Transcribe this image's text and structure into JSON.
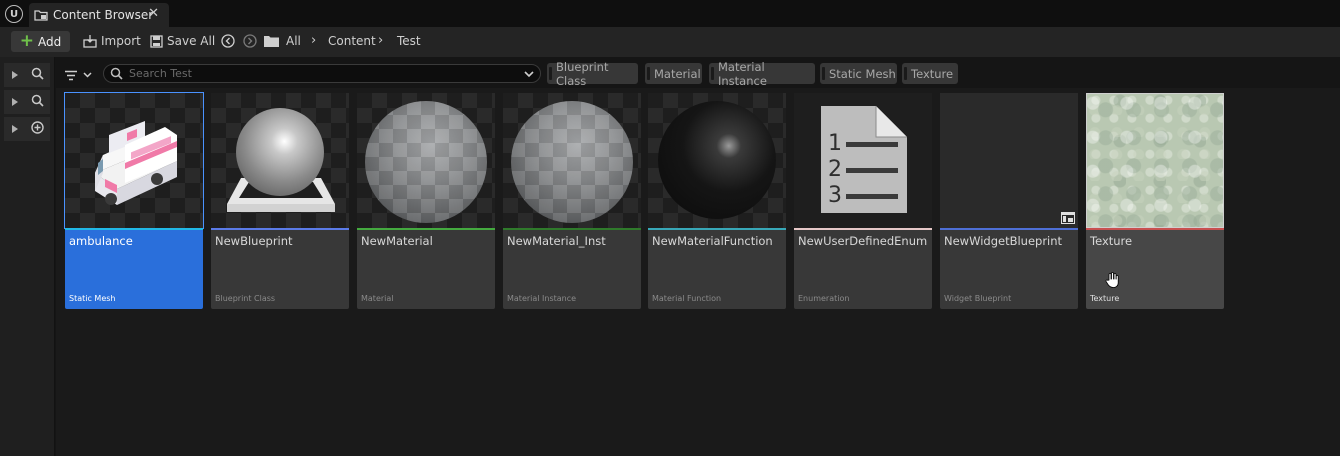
{
  "tab": {
    "title": "Content Browser",
    "close": "✕"
  },
  "toolbar": {
    "add_label": "Add",
    "import_label": "Import",
    "save_all_label": "Save All",
    "breadcrumbs": [
      "All",
      "Content",
      "Test"
    ]
  },
  "search": {
    "placeholder": "Search Test"
  },
  "filters": [
    "Blueprint Class",
    "Material",
    "Material Instance",
    "Static Mesh",
    "Texture"
  ],
  "assets": [
    {
      "name": "ambulance",
      "type": "Static Mesh",
      "color": "#21b8e6"
    },
    {
      "name": "NewBlueprint",
      "type": "Blueprint Class",
      "color": "#5b7be8"
    },
    {
      "name": "NewMaterial",
      "type": "Material",
      "color": "#44aa3f"
    },
    {
      "name": "NewMaterial_Inst",
      "type": "Material Instance",
      "color": "#2f7a2b"
    },
    {
      "name": "NewMaterialFunction",
      "type": "Material Function",
      "color": "#38a8b8"
    },
    {
      "name": "NewUserDefinedEnum",
      "type": "Enumeration",
      "color": "#e6c8c8"
    },
    {
      "name": "NewWidgetBlueprint",
      "type": "Widget Blueprint",
      "color": "#4e6fd6"
    },
    {
      "name": "Texture",
      "type": "Texture",
      "color": "#c85050"
    }
  ],
  "enum_icon_digits": [
    "1",
    "2",
    "3"
  ]
}
